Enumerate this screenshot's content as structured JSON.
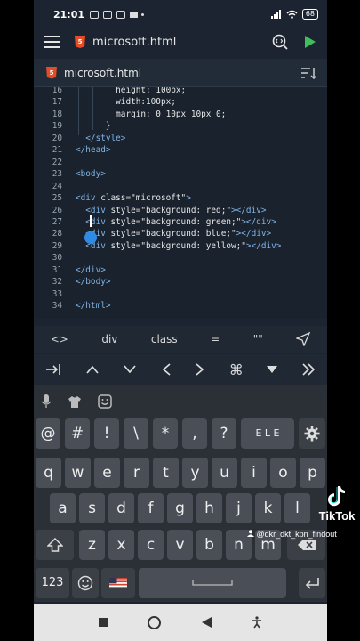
{
  "status_bar": {
    "time": "21:01",
    "battery": "68"
  },
  "toolbar": {
    "title": "microsoft.html",
    "html_badge": "5"
  },
  "tab": {
    "label": "microsoft.html"
  },
  "editor": {
    "lines": [
      {
        "n": "16",
        "segs": [
          {
            "t": "        height: 100px;",
            "c": "plain"
          }
        ]
      },
      {
        "n": "17",
        "segs": [
          {
            "t": "        width:100px;",
            "c": "plain"
          }
        ]
      },
      {
        "n": "18",
        "segs": [
          {
            "t": "        margin: 0 10px 10px 0;",
            "c": "plain"
          }
        ]
      },
      {
        "n": "19",
        "segs": [
          {
            "t": "      }",
            "c": "plain"
          }
        ]
      },
      {
        "n": "20",
        "segs": [
          {
            "t": "  </style>",
            "c": "tag"
          }
        ]
      },
      {
        "n": "21",
        "segs": [
          {
            "t": "</head>",
            "c": "tag"
          }
        ]
      },
      {
        "n": "22",
        "segs": [
          {
            "t": "",
            "c": "plain"
          }
        ]
      },
      {
        "n": "23",
        "segs": [
          {
            "t": "<body>",
            "c": "tag"
          }
        ]
      },
      {
        "n": "24",
        "segs": [
          {
            "t": "",
            "c": "plain"
          }
        ]
      },
      {
        "n": "25",
        "segs": [
          {
            "t": "<div ",
            "c": "tag"
          },
          {
            "t": "class=",
            "c": "attr"
          },
          {
            "t": "\"microsoft\"",
            "c": "str"
          },
          {
            "t": ">",
            "c": "tag"
          }
        ]
      },
      {
        "n": "26",
        "segs": [
          {
            "t": "  <div ",
            "c": "tag"
          },
          {
            "t": "style=",
            "c": "attr"
          },
          {
            "t": "\"background: red;\"",
            "c": "str"
          },
          {
            "t": "></div>",
            "c": "tag"
          }
        ]
      },
      {
        "n": "27",
        "segs": [
          {
            "t": "  <div ",
            "c": "tag"
          },
          {
            "t": "style=",
            "c": "attr"
          },
          {
            "t": "\"background: green;\"",
            "c": "str"
          },
          {
            "t": "></div>",
            "c": "tag"
          }
        ]
      },
      {
        "n": "28",
        "segs": [
          {
            "t": "  <div ",
            "c": "tag"
          },
          {
            "t": "style=",
            "c": "attr"
          },
          {
            "t": "\"background: blue;\"",
            "c": "str"
          },
          {
            "t": "></div>",
            "c": "tag"
          }
        ]
      },
      {
        "n": "29",
        "segs": [
          {
            "t": "  <div ",
            "c": "tag"
          },
          {
            "t": "style=",
            "c": "attr"
          },
          {
            "t": "\"background: yellow;\"",
            "c": "str"
          },
          {
            "t": "></div>",
            "c": "tag"
          }
        ]
      },
      {
        "n": "30",
        "segs": [
          {
            "t": "",
            "c": "plain"
          }
        ]
      },
      {
        "n": "31",
        "segs": [
          {
            "t": "</div>",
            "c": "tag"
          }
        ]
      },
      {
        "n": "32",
        "segs": [
          {
            "t": "</body>",
            "c": "tag"
          }
        ]
      },
      {
        "n": "33",
        "segs": [
          {
            "t": "",
            "c": "plain"
          }
        ]
      },
      {
        "n": "34",
        "segs": [
          {
            "t": "</html>",
            "c": "tag"
          }
        ]
      }
    ]
  },
  "symbols": [
    "<>",
    "div",
    "class",
    "=",
    "\"\""
  ],
  "nav_keys": [
    "→|",
    "^",
    "v",
    "<",
    ">",
    "⌘",
    "▼",
    "»"
  ],
  "keyboard": {
    "row0": [
      "@",
      "#",
      "!",
      "\\",
      "*",
      ",",
      "?"
    ],
    "row0_special": "E L E",
    "row1": [
      "q",
      "w",
      "e",
      "r",
      "t",
      "y",
      "u",
      "i",
      "o",
      "p"
    ],
    "row2": [
      "a",
      "s",
      "d",
      "f",
      "g",
      "h",
      "j",
      "k",
      "l"
    ],
    "row3": [
      "z",
      "x",
      "c",
      "v",
      "b",
      "n",
      "m"
    ],
    "numbers_key": "123"
  },
  "overlay": {
    "brand": "TikTok",
    "user": "@dkr_dkt_kpn_findout"
  },
  "colors": {
    "background": "#1b2430",
    "keyboard": "#2b2f36",
    "run": "#3fbf5a",
    "html5": "#e44d26"
  }
}
